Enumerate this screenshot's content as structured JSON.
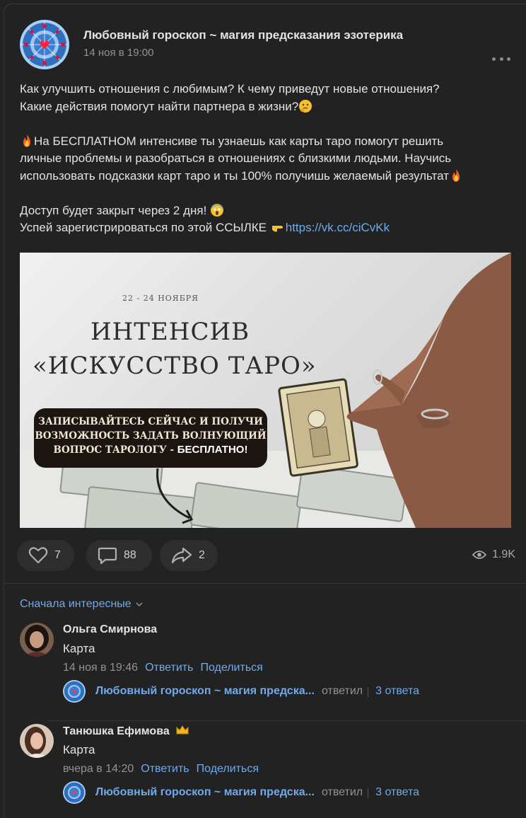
{
  "post": {
    "group_name": "Любовный гороскоп ~ магия предсказания эзотерика",
    "date": "14 ноя в 19:00",
    "text": {
      "line1": "Как улучшить отношения с любимым? К чему приведут новые отношения?",
      "line2": "Какие действия помогут найти партнера в жизни?",
      "line3": "На БЕСПЛАТНОМ интенсиве ты узнаешь как карты таро помогут решить",
      "line4": "личные проблемы и разобраться в отношениях с близкими людьми. Научись",
      "line5": "использовать подсказки карт таро и ты 100% получишь желаемый результат",
      "line6": "Доступ будет закрыт через 2 дня!",
      "line7": "Успей зарегистрироваться по этой ССЫЛКЕ",
      "link": "https://vk.cc/ciCvKk"
    },
    "image": {
      "date": "22 - 24 НОЯБРЯ",
      "title1": "ИНТЕНСИВ",
      "title2": "«ИСКУССТВО ТАРО»",
      "banner1": "ЗАПИСЫВАЙТЕСЬ СЕЙЧАС И ПОЛУЧИ",
      "banner2": "ВОЗМОЖНОСТЬ ЗАДАТЬ ВОЛНУЮЩИЙ",
      "banner3": "ВОПРОС ТАРОЛОГУ -",
      "banner_free": "БЕСПЛАТНО!"
    },
    "likes": "7",
    "comments": "88",
    "shares": "2",
    "views": "1.9K"
  },
  "comments_section": {
    "sort_label": "Сначала интересные",
    "items": [
      {
        "author": "Ольга Смирнова",
        "text": "Карта",
        "date": "14 ноя в 19:46",
        "reply_action": "Ответить",
        "share_action": "Поделиться",
        "reply_from": "Любовный гороскоп ~ магия предска...",
        "reply_verb": "ответил",
        "reply_count": "3 ответа"
      },
      {
        "author": "Танюшка Ефимова",
        "text": "Карта",
        "date": "вчера в 14:20",
        "reply_action": "Ответить",
        "share_action": "Поделиться",
        "reply_from": "Любовный гороскоп ~ магия предска...",
        "reply_verb": "ответил",
        "reply_count": "3 ответа"
      }
    ]
  },
  "colors": {
    "background": "#222222",
    "link": "#71aaeb",
    "secondary_text": "#939393",
    "pill": "#2e2e2e"
  }
}
